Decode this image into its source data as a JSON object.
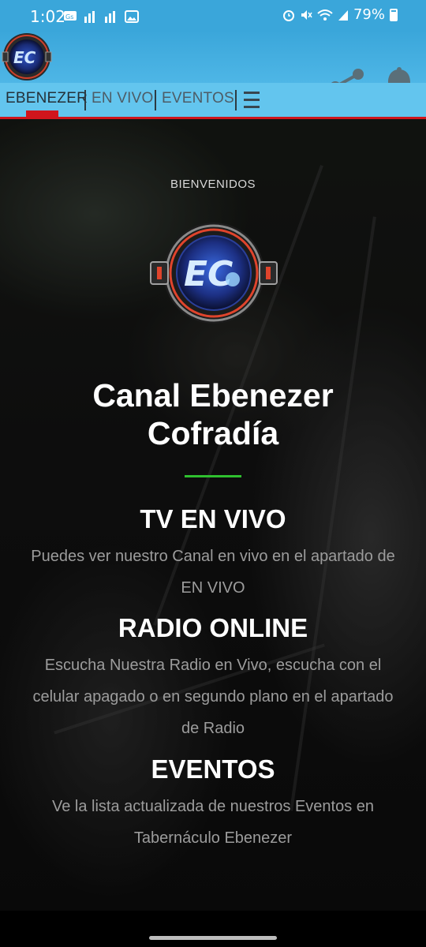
{
  "status_bar": {
    "time": "1:02",
    "battery": "79%"
  },
  "app_bar": {
    "logo_icon": "ebenezer-logo-icon",
    "share_icon": "share-icon",
    "bell_icon": "bell-icon"
  },
  "tabs": {
    "items": [
      {
        "label": "EBENEZER",
        "active": true
      },
      {
        "label": "EN VIVO",
        "active": false
      },
      {
        "label": "EVENTOS",
        "active": false
      }
    ],
    "menu_icon": "menu-icon",
    "accent_color": "#d0151c"
  },
  "hero": {
    "welcome": "BIENVENIDOS",
    "title_line1": "Canal Ebenezer",
    "title_line2": "Cofradía",
    "underline_color": "#2fc02f",
    "sections": [
      {
        "title": "TV EN VIVO",
        "text": "Puedes ver nuestro Canal en vivo en el apartado de EN VIVO"
      },
      {
        "title": "RADIO ONLINE",
        "text": "Escucha Nuestra Radio en Vivo, escucha con el celular apagado o en segundo plano en el apartado de Radio"
      },
      {
        "title": "EVENTOS",
        "text": "Ve la lista actualizada de nuestros Eventos en Tabernáculo Ebenezer"
      }
    ]
  }
}
